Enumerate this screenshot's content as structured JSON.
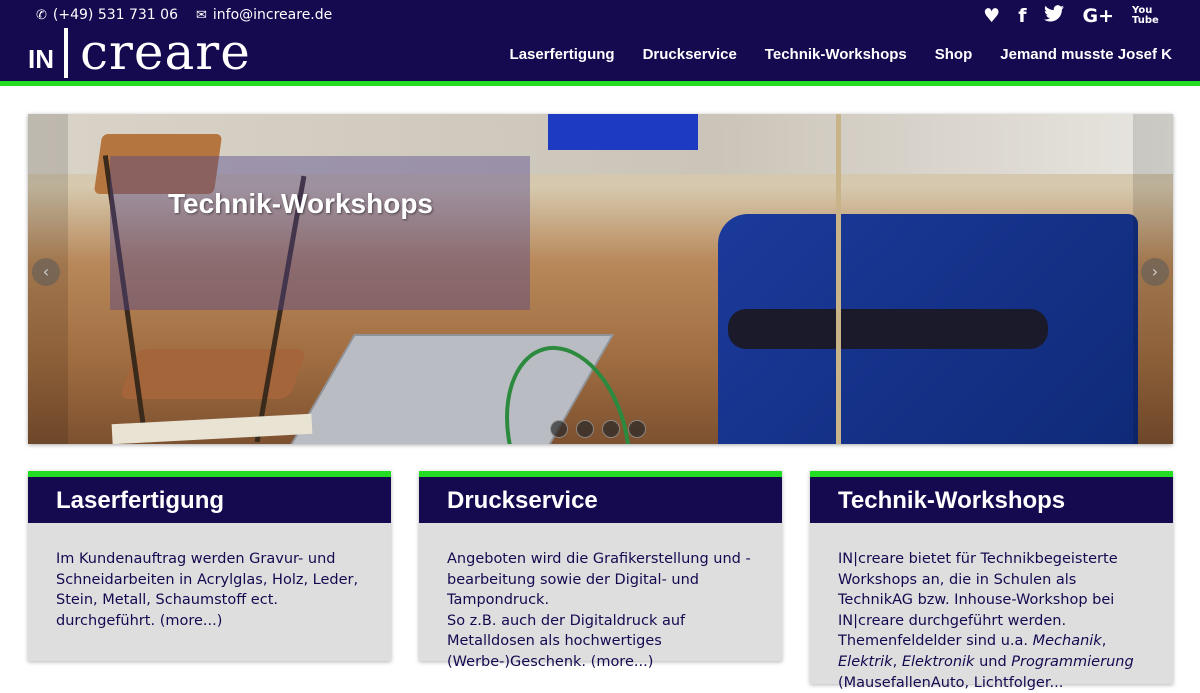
{
  "header": {
    "phone": "(+49) 531 731 06",
    "email": "info@increare.de",
    "logo_in": "IN",
    "logo_creare": "creare",
    "social": [
      "heart-icon",
      "facebook-icon",
      "twitter-icon",
      "google-plus-icon",
      "youtube-icon"
    ],
    "social_labels": {
      "facebook": "f",
      "google": "G+",
      "youtube": "You Tube"
    },
    "nav": [
      "Laserfertigung",
      "Druckservice",
      "Technik-Workshops",
      "Shop",
      "Jemand musste Josef K"
    ]
  },
  "slider": {
    "caption": "Technik-Workshops",
    "slide_count": 4,
    "active_slide": 1
  },
  "cards": [
    {
      "title": "Laserfertigung",
      "text": "Im Kundenauftrag werden Gravur- und Schneidarbeiten in Acrylglas, Holz, Leder, Stein, Metall, Schaumstoff ect. durchgeführt.",
      "more": "(more...)"
    },
    {
      "title": "Druckservice",
      "text1": "Angeboten wird die Grafikerstellung und -bearbeitung sowie der Digital- und Tampondruck.",
      "text2": "So z.B. auch der Digitaldruck auf Metalldosen als hochwertiges (Werbe-)Geschenk.",
      "more": "(more...)"
    },
    {
      "title": "Technik-Workshops",
      "text1": "IN|creare bietet für Technikbegeisterte Workshops an, die in Schulen als TechnikAG bzw. Inhouse-Workshop bei IN|creare durchgeführt werden.",
      "text2_prefix": "Themenfeldelder sind u.a.",
      "topic1": "Mechanik",
      "topic2": "Elektrik",
      "topic3": "Elektronik",
      "and": "und",
      "topic4": "Programmierung",
      "text3": "(MausefallenAuto, Lichtfolger..."
    }
  ],
  "colors": {
    "navy": "#150950",
    "green": "#22dd22",
    "card_bg": "#dedede"
  }
}
